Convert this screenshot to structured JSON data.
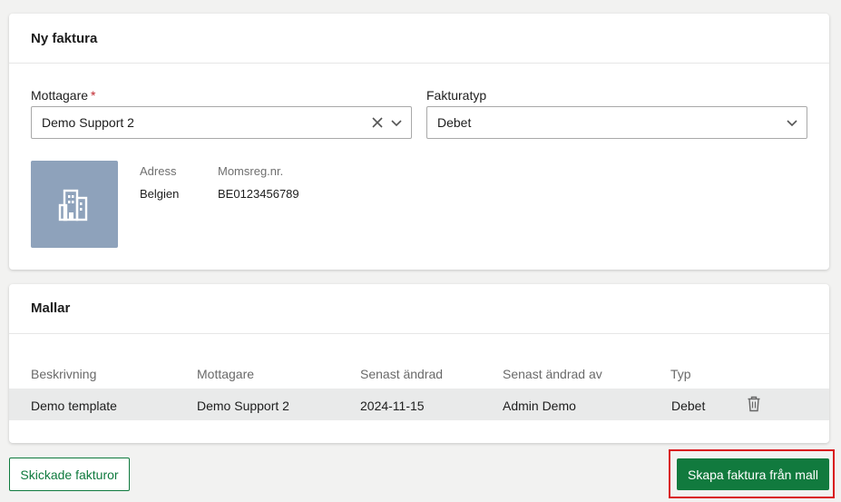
{
  "new_invoice": {
    "title": "Ny faktura",
    "recipient_label": "Mottagare",
    "required_mark": "*",
    "recipient_value": "Demo Support 2",
    "invoice_type_label": "Fakturatyp",
    "invoice_type_value": "Debet",
    "address_label": "Adress",
    "address_value": "Belgien",
    "vat_label": "Momsreg.nr.",
    "vat_value": "BE0123456789"
  },
  "templates": {
    "title": "Mallar",
    "columns": [
      "Beskrivning",
      "Mottagare",
      "Senast ändrad",
      "Senast ändrad av",
      "Typ"
    ],
    "rows": [
      [
        "Demo template",
        "Demo Support 2",
        "2024-11-15",
        "Admin Demo",
        "Debet"
      ]
    ]
  },
  "footer": {
    "sent_invoices_label": "Skickade fakturor",
    "create_from_template_label": "Skapa faktura från mall"
  },
  "colors": {
    "primary_green": "#117a3e",
    "required_red": "#c0262d",
    "highlight_red": "#d9161c",
    "avatar_blue_gray": "#8ea2bb"
  },
  "icons": [
    "clear-icon",
    "chevron-down-icon",
    "building-icon",
    "trash-icon"
  ]
}
